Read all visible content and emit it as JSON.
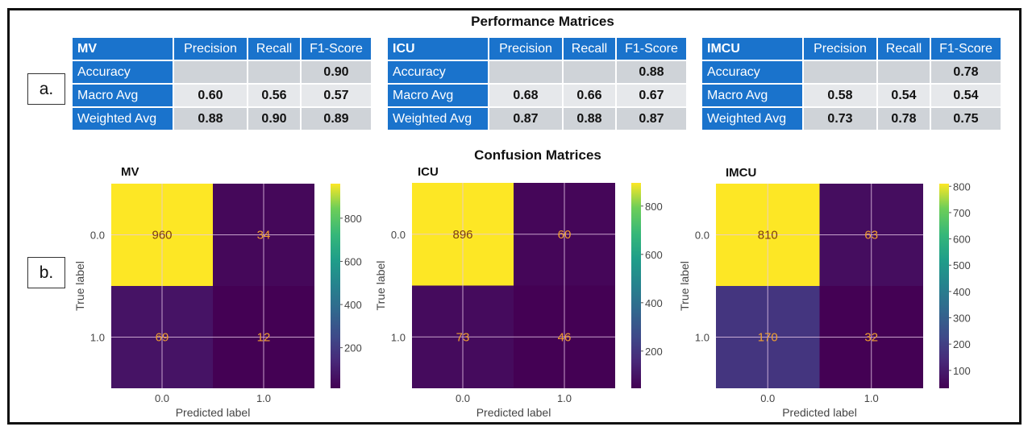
{
  "performance": {
    "title": "Performance Matrices",
    "panel_label": "a.",
    "columns": [
      "Precision",
      "Recall",
      "F1-Score"
    ],
    "row_labels": [
      "Accuracy",
      "Macro Avg",
      "Weighted Avg"
    ],
    "tables": [
      {
        "name": "MV",
        "rows": [
          [
            "",
            "",
            "0.90"
          ],
          [
            "0.60",
            "0.56",
            "0.57"
          ],
          [
            "0.88",
            "0.90",
            "0.89"
          ]
        ]
      },
      {
        "name": "ICU",
        "rows": [
          [
            "",
            "",
            "0.88"
          ],
          [
            "0.68",
            "0.66",
            "0.67"
          ],
          [
            "0.87",
            "0.88",
            "0.87"
          ]
        ]
      },
      {
        "name": "IMCU",
        "rows": [
          [
            "",
            "",
            "0.78"
          ],
          [
            "0.58",
            "0.54",
            "0.54"
          ],
          [
            "0.73",
            "0.78",
            "0.75"
          ]
        ]
      }
    ]
  },
  "confusion": {
    "title": "Confusion Matrices",
    "panel_label": "b."
  },
  "colors": {
    "table_header": "#1a73cc",
    "cell_gray": "#cfd3d8",
    "cell_light": "#e6e8eb",
    "annotation": "#f0a030"
  },
  "chart_data": [
    {
      "type": "heatmap",
      "title": "MV",
      "xlabel": "Predicted label",
      "ylabel": "True label",
      "x_ticks": [
        "0.0",
        "1.0"
      ],
      "y_ticks": [
        "0.0",
        "1.0"
      ],
      "matrix": [
        [
          960,
          34
        ],
        [
          69,
          12
        ]
      ],
      "colormap": "viridis",
      "colorbar_ticks": [
        200,
        400,
        600,
        800
      ],
      "colorbar_range": [
        12,
        960
      ]
    },
    {
      "type": "heatmap",
      "title": "ICU",
      "xlabel": "Predicted label",
      "ylabel": "True label",
      "x_ticks": [
        "0.0",
        "1.0"
      ],
      "y_ticks": [
        "0.0",
        "1.0"
      ],
      "matrix": [
        [
          896,
          60
        ],
        [
          73,
          46
        ]
      ],
      "colormap": "viridis",
      "colorbar_ticks": [
        200,
        400,
        600,
        800
      ],
      "colorbar_range": [
        46,
        896
      ]
    },
    {
      "type": "heatmap",
      "title": "IMCU",
      "xlabel": "Predicted label",
      "ylabel": "True label",
      "x_ticks": [
        "0.0",
        "1.0"
      ],
      "y_ticks": [
        "0.0",
        "1.0"
      ],
      "matrix": [
        [
          810,
          63
        ],
        [
          170,
          32
        ]
      ],
      "colormap": "viridis",
      "colorbar_ticks": [
        100,
        200,
        300,
        400,
        500,
        600,
        700,
        800
      ],
      "colorbar_range": [
        32,
        810
      ]
    }
  ]
}
